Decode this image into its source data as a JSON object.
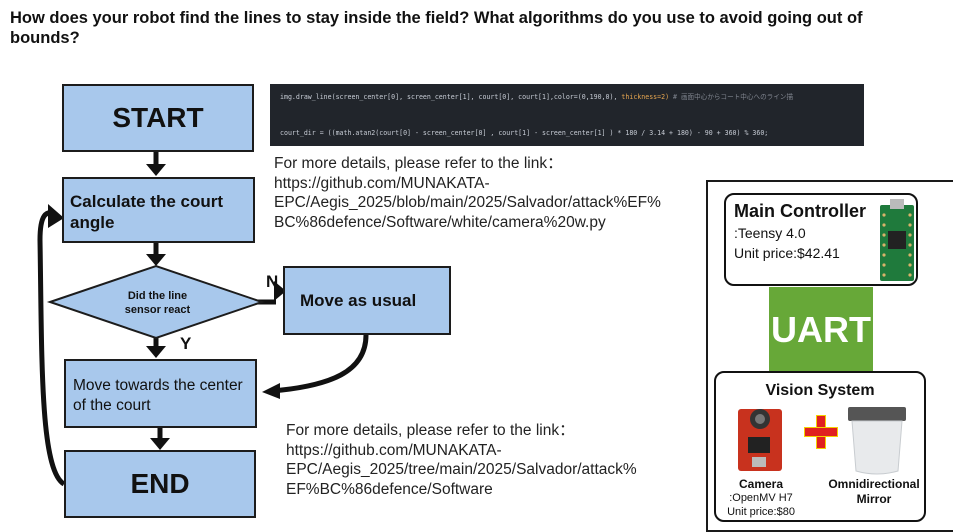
{
  "question": "How does your robot find the lines to stay inside the field? What algorithms do you use to avoid going out of bounds?",
  "flowchart": {
    "start": "START",
    "calc": "Calculate the court angle",
    "decision": "Did the line sensor react",
    "no_label": "N",
    "yes_label": "Y",
    "move_usual": "Move as usual",
    "move_center": "Move towards the center of the court",
    "end": "END"
  },
  "code": {
    "line1_pre": "img.draw_line(screen_center[0], screen_center[1], court[0], court[1],color=(0,190,0), ",
    "line1_kw": "thickness=2)",
    "line1_comment": " # 画面中心からコート中心へのライン描",
    "line2": "court_dir = ((math.atan2(court[0] - screen_center[0] , court[1] - screen_center[1] ) * 180 / 3.14 + 180) - 90 + 360) % 360;"
  },
  "links": {
    "top": "For more details, please refer to the link：\nhttps://github.com/MUNAKATA-\nEPC/Aegis_2025/blob/main/2025/Salvador/attack%EF%\nBC%86defence/Software/white/camera%20w.py",
    "bottom": "For more details, please refer to the link：\nhttps://github.com/MUNAKATA-\nEPC/Aegis_2025/tree/main/2025/Salvador/attack%\nEF%BC%86defence/Software"
  },
  "hardware": {
    "main_title": "Main Controller",
    "main_model": ":Teensy 4.0",
    "main_price": "Unit price:$42.41",
    "uart": "UART",
    "vision_title": "Vision System",
    "camera_title": "Camera",
    "camera_model": ":OpenMV H7",
    "camera_price": "Unit price:$80",
    "mirror_title": "Omnidirectional\nMirror",
    "plus": "+"
  }
}
